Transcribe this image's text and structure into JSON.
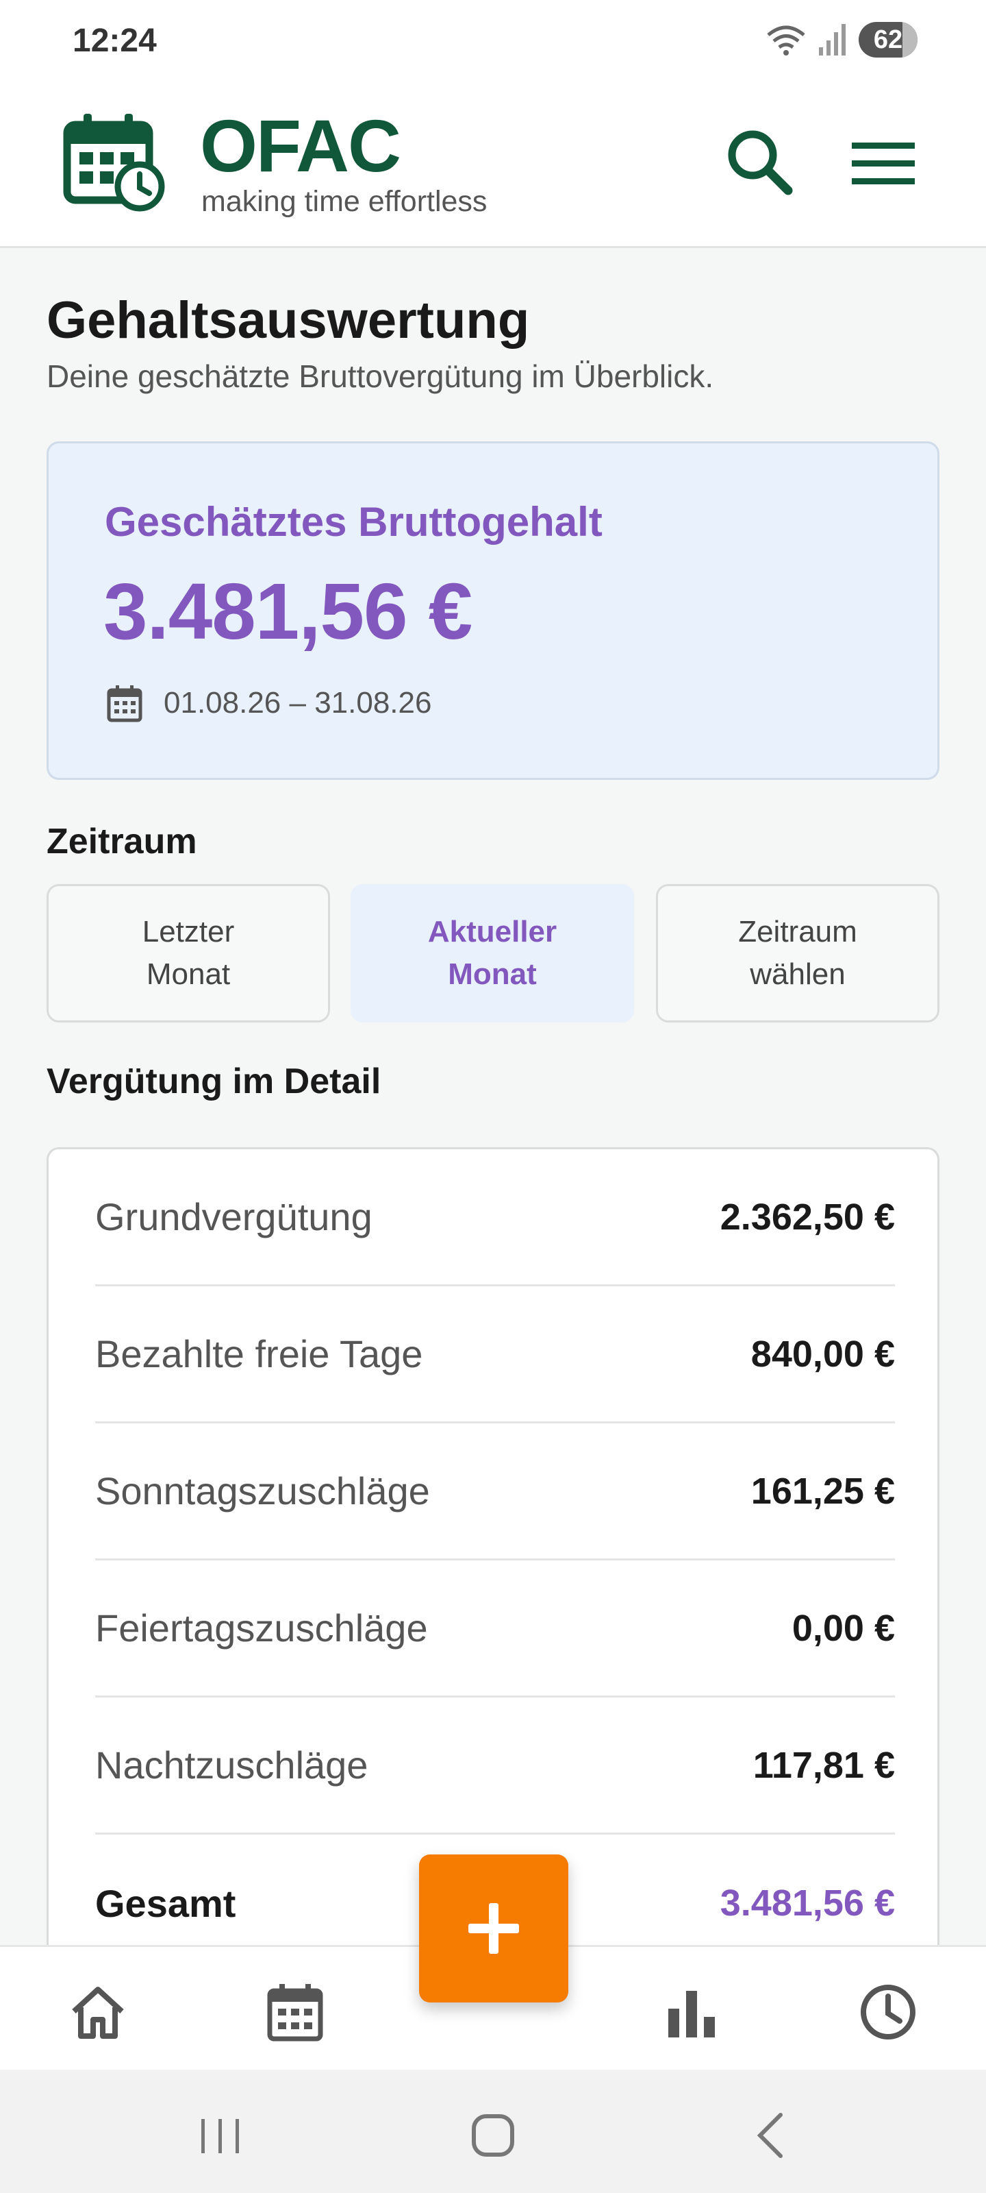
{
  "status_bar": {
    "time": "12:24",
    "battery": "62",
    "icons": [
      "wifi-icon",
      "signal-icon",
      "battery-icon"
    ]
  },
  "header": {
    "app_name": "OFAC",
    "tagline": "making time effortless",
    "icons": [
      "calendar-clock-logo-icon",
      "search-icon",
      "menu-icon"
    ]
  },
  "page": {
    "title": "Gehaltsauswertung",
    "subtitle": "Deine geschätzte Bruttovergütung im Überblick."
  },
  "summary": {
    "label": "Geschätztes Bruttogehalt",
    "amount": "3.481,56 €",
    "date_range": "01.08.26 – 31.08.26"
  },
  "period": {
    "heading": "Zeitraum",
    "options": [
      {
        "line1": "Letzter",
        "line2": "Monat",
        "active": false
      },
      {
        "line1": "Aktueller",
        "line2": "Monat",
        "active": true
      },
      {
        "line1": "Zeitraum",
        "line2": "wählen",
        "active": false
      }
    ]
  },
  "details": {
    "heading": "Vergütung im Detail",
    "rows": [
      {
        "label": "Grundvergütung",
        "value": "2.362,50 €"
      },
      {
        "label": "Bezahlte freie Tage",
        "value": "840,00 €"
      },
      {
        "label": "Sonntagszuschläge",
        "value": "161,25 €"
      },
      {
        "label": "Feiertagszuschläge",
        "value": "0,00 €"
      },
      {
        "label": "Nachtzuschläge",
        "value": "117,81 €"
      }
    ],
    "total": {
      "label": "Gesamt",
      "value": "3.481,56 €"
    }
  },
  "bottom_nav": [
    "home-icon",
    "calendar-icon",
    "add-icon",
    "bar-chart-icon",
    "clock-icon"
  ],
  "colors": {
    "brand_green": "#11573a",
    "accent_purple": "#8358be",
    "fab_orange": "#f57c00",
    "summary_bg": "#e8f1fc"
  }
}
